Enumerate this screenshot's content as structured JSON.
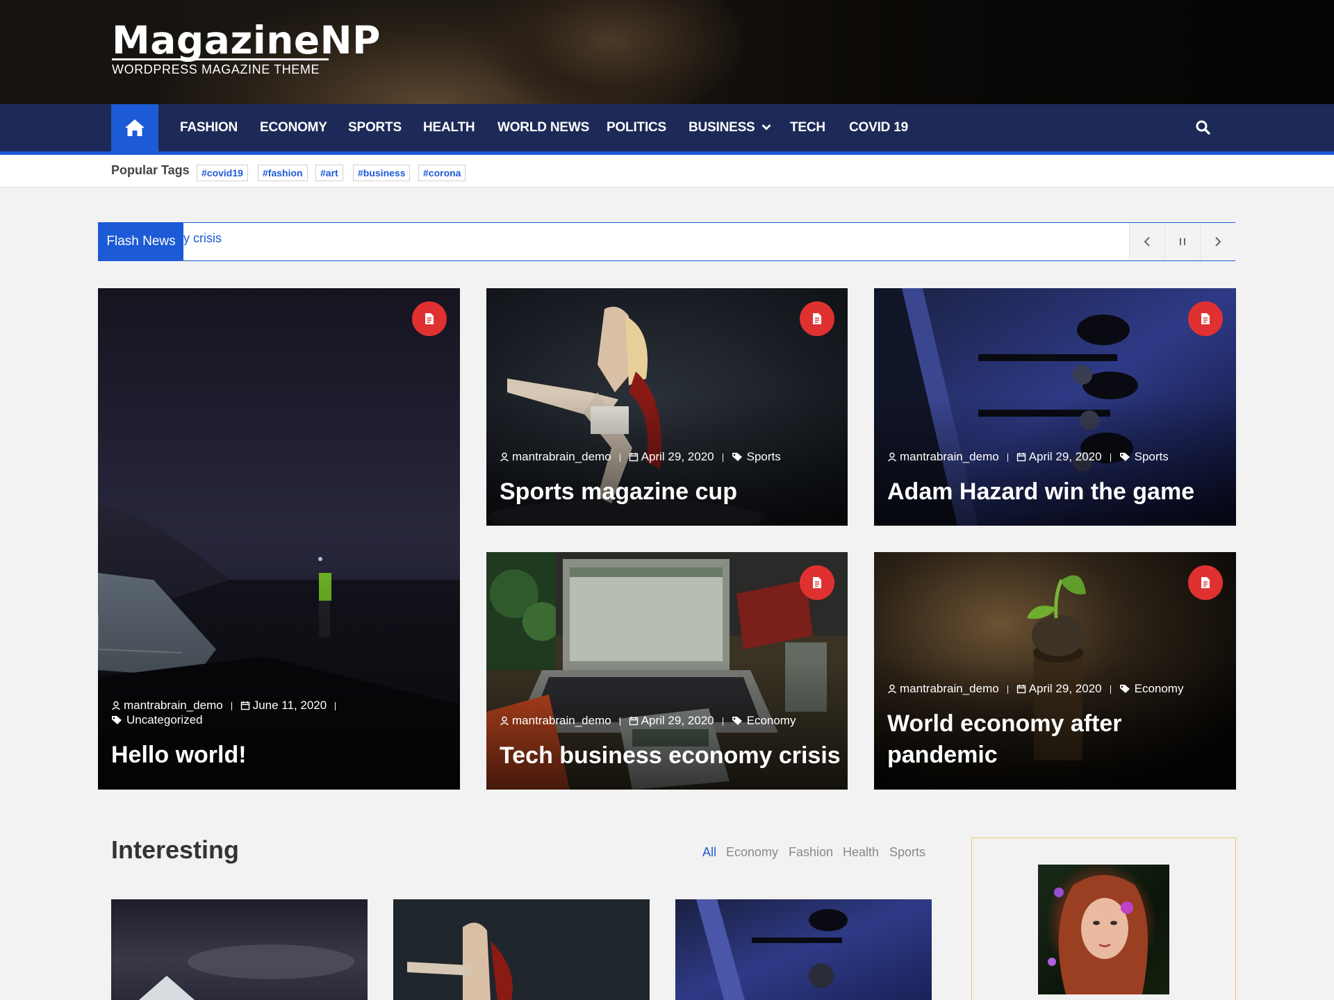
{
  "header": {
    "logo_title": "MagazineNP",
    "logo_tagline": "WORDPRESS MAGAZINE THEME"
  },
  "nav": {
    "items": [
      {
        "label": "FASHION"
      },
      {
        "label": "ECONOMY"
      },
      {
        "label": "SPORTS"
      },
      {
        "label": "HEALTH"
      },
      {
        "label": "WORLD NEWS"
      },
      {
        "label": "POLITICS"
      },
      {
        "label": "BUSINESS"
      },
      {
        "label": "TECH"
      },
      {
        "label": "COVID 19"
      }
    ],
    "home_icon": "home-icon",
    "search_icon": "search-icon",
    "dropdown_icon": "chevron-down-icon"
  },
  "tags": {
    "label": "Popular Tags",
    "items": [
      "#covid19",
      "#fashion",
      "#art",
      "#business",
      "#corona"
    ]
  },
  "flash": {
    "label": "Flash News",
    "text": "y crisis"
  },
  "featured": [
    {
      "author": "mantrabrain_demo",
      "date": "June 11, 2020",
      "category": "Uncategorized",
      "title": "Hello world!"
    },
    {
      "author": "mantrabrain_demo",
      "date": "April 29, 2020",
      "category": "Sports",
      "title": "Sports magazine cup"
    },
    {
      "author": "mantrabrain_demo",
      "date": "April 29, 2020",
      "category": "Sports",
      "title": "Adam Hazard win the game"
    },
    {
      "author": "mantrabrain_demo",
      "date": "April 29, 2020",
      "category": "Economy",
      "title": "Tech business economy crisis"
    },
    {
      "author": "mantrabrain_demo",
      "date": "April 29, 2020",
      "category": "Economy",
      "title_line1": "World economy after",
      "title_line2": "pandemic"
    }
  ],
  "interesting": {
    "title": "Interesting",
    "filters": [
      "All",
      "Economy",
      "Fashion",
      "Health",
      "Sports"
    ]
  },
  "colors": {
    "nav_bg": "#1d2a57",
    "accent": "#1d5ad6",
    "badge": "#e03131"
  }
}
